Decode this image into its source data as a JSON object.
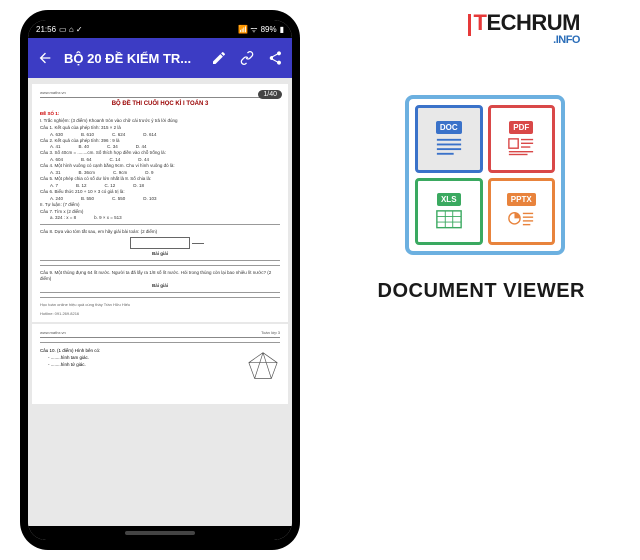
{
  "statusbar": {
    "time": "21:56",
    "signal": "89%"
  },
  "appbar": {
    "title": "BỘ 20 ĐỀ KIỂM TR..."
  },
  "counter": "1/40",
  "doc_source": "www.mathx.vn",
  "doc_right": "Toán lớp 3",
  "doc_title": "BỘ ĐỀ THI CUỐI HỌC KÌ I TOÁN 3",
  "de_so": "ĐỀ SỐ 1:",
  "tn": "I. Trắc nghiệm: (3 điểm) Khoanh tròn vào chữ cái trước ý trả lời đúng",
  "c1": "Câu 1. Kết quả của phép tính: 315 × 2 là",
  "c1o": {
    "a": "A. 630",
    "b": "B. 610",
    "c": "C. 624",
    "d": "D. 614"
  },
  "c2": "Câu 2. Kết quả của phép tính: 396 : 9 là",
  "c2o": {
    "a": "A. 41",
    "b": "B. 40",
    "c": "C. 34",
    "d": "D. 44"
  },
  "c3": "Câu 3. Số 40cm = ........cm. Số thích hợp điền vào chỗ trống là:",
  "c3o": {
    "a": "A. 604",
    "b": "B. 64",
    "c": "C. 14",
    "d": "D. 44"
  },
  "c4": "Câu 4. Một hình vuông có cạnh bằng 9cm. Chu vi hình vuông đó là:",
  "c4o": {
    "a": "A. 31",
    "b": "B. 36cm",
    "c": "C. 9cm",
    "d": "D. 9"
  },
  "c5": "Câu 5. Một phép chia có số dư lớn nhất là 8. Số chia là:",
  "c5o": {
    "a": "A. 7",
    "b": "B. 12",
    "c": "C. 12",
    "d": "D. 18"
  },
  "c6": "Câu 6. Biểu thức 210 + 10 × 3 có giá trị là:",
  "c6o": {
    "a": "A. 240",
    "b": "B. 550",
    "c": "C. 550",
    "d": "D. 103"
  },
  "tl": "II. Tự luận: (7 điểm)",
  "c7": "Câu 7. Tìm x (2 điểm)",
  "c7a": "a. 324 : x = 8",
  "c7b": "b. 9 × x = 513",
  "c8": "Câu 8. Dựa vào tóm tắt sau, em hãy giải bài toán: (2 điểm)",
  "bg": "Bài giải",
  "c9": "Câu 9. Một thùng đựng 64 lít nước. Người ta đã lấy ra 1/8 số lít nước. Hỏi trong thùng còn lại bao nhiêu lít nước? (2 điểm)",
  "footer1": "Học toán online hiệu quả cùng thầy Trần Hữu Hiếu",
  "footer2": "Hotline: 091.269.8216",
  "c10": "Câu 10. (1 điểm) Hình bên có:",
  "c10a": "- ........hình tam giác.",
  "c10b": "- ........hình tứ giác.",
  "appname": "DOCUMENT VIEWER",
  "logo": {
    "t": "T",
    "rest": "ECHRUM",
    "info": ".INFO"
  },
  "formats": {
    "doc": "DOC",
    "pdf": "PDF",
    "xls": "XLS",
    "ppt": "PPTX"
  }
}
